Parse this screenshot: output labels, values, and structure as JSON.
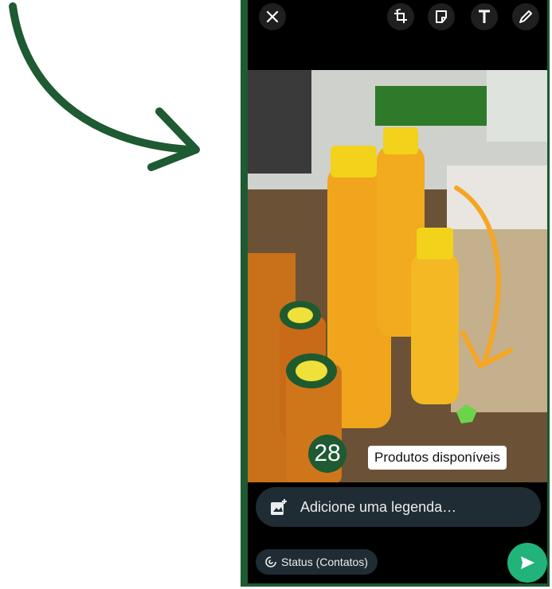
{
  "annotation": {
    "step_number": "28",
    "color": "#1e5a32"
  },
  "toolbar": {
    "icons": [
      "close-icon",
      "crop-rotate-icon",
      "sticker-icon",
      "text-icon",
      "pencil-icon"
    ]
  },
  "photo": {
    "sticker_text": "Produtos disponíveis"
  },
  "composer": {
    "caption_placeholder": "Adicione uma legenda…"
  },
  "audience": {
    "label": "Status (Contatos)"
  },
  "colors": {
    "accent": "#21b37a",
    "input_bg": "#1f2c33",
    "drawn_arrow": "#f5a623"
  }
}
